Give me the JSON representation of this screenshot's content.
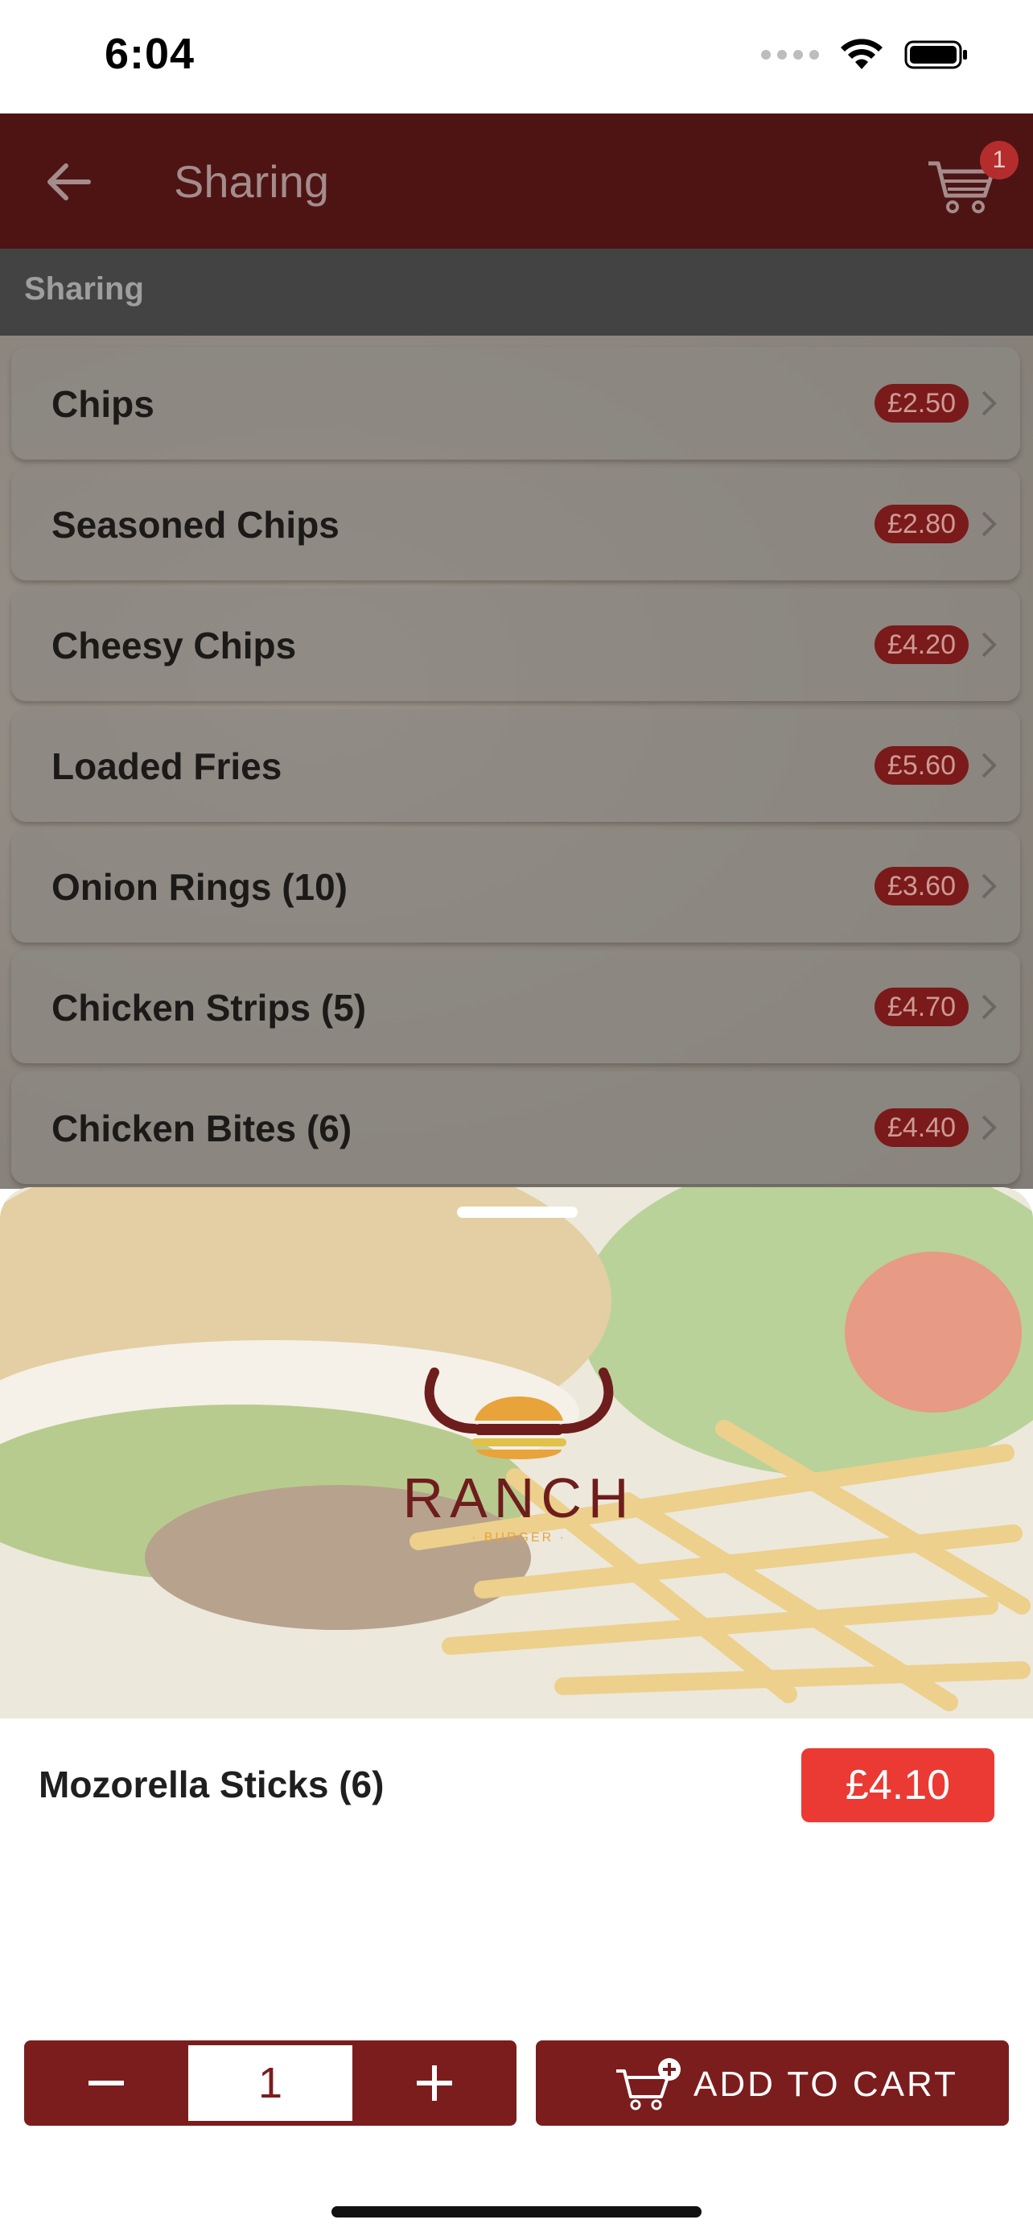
{
  "status_bar": {
    "time": "6:04"
  },
  "header": {
    "title": "Sharing",
    "cart_count": "1"
  },
  "section": {
    "label": "Sharing"
  },
  "menu_items": [
    {
      "name": "Chips",
      "price": "£2.50"
    },
    {
      "name": "Seasoned Chips",
      "price": "£2.80"
    },
    {
      "name": "Cheesy Chips",
      "price": "£4.20"
    },
    {
      "name": "Loaded Fries",
      "price": "£5.60"
    },
    {
      "name": "Onion Rings (10)",
      "price": "£3.60"
    },
    {
      "name": "Chicken Strips (5)",
      "price": "£4.70"
    },
    {
      "name": "Chicken Bites (6)",
      "price": "£4.40"
    }
  ],
  "product": {
    "logo_text": "RANCH",
    "logo_subtext": "· BURGER ·",
    "name": "Mozorella Sticks (6)",
    "price": "£4.10",
    "quantity": "1",
    "add_to_cart_label": "ADD TO CART"
  },
  "colors": {
    "header_bg": "#4e1414",
    "accent": "#7b1d1d",
    "price_red": "#ea3a33"
  },
  "icons": [
    "back-arrow-icon",
    "cart-icon",
    "chevron-right-icon",
    "minus-icon",
    "plus-icon",
    "add-to-cart-icon",
    "wifi-icon",
    "battery-icon",
    "signal-icon"
  ]
}
